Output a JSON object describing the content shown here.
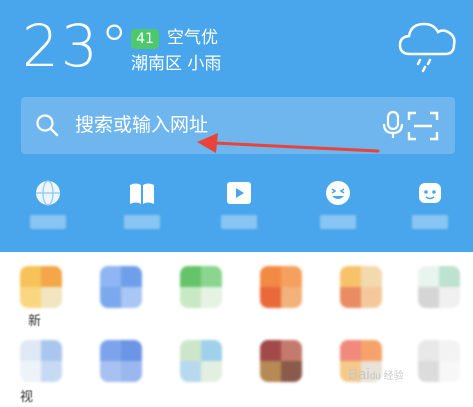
{
  "weather": {
    "temperature": "23°",
    "aqi_value": "41",
    "aqi_label": "空气优",
    "location": "潮南区 小雨",
    "icon": "cloud-rain-icon"
  },
  "search": {
    "placeholder": "搜索或输入网址",
    "voice_icon": "microphone-icon",
    "scan_icon": "scan-icon"
  },
  "grid": {
    "labels": [
      "新",
      "视"
    ]
  },
  "watermark": {
    "text": "Bai",
    "sub": "du 经验"
  },
  "colors": {
    "header_bg": "#4aa6ec",
    "search_bg": "#6fb6ef",
    "aqi_badge": "#4dc86a",
    "arrow": "#e8443a"
  }
}
